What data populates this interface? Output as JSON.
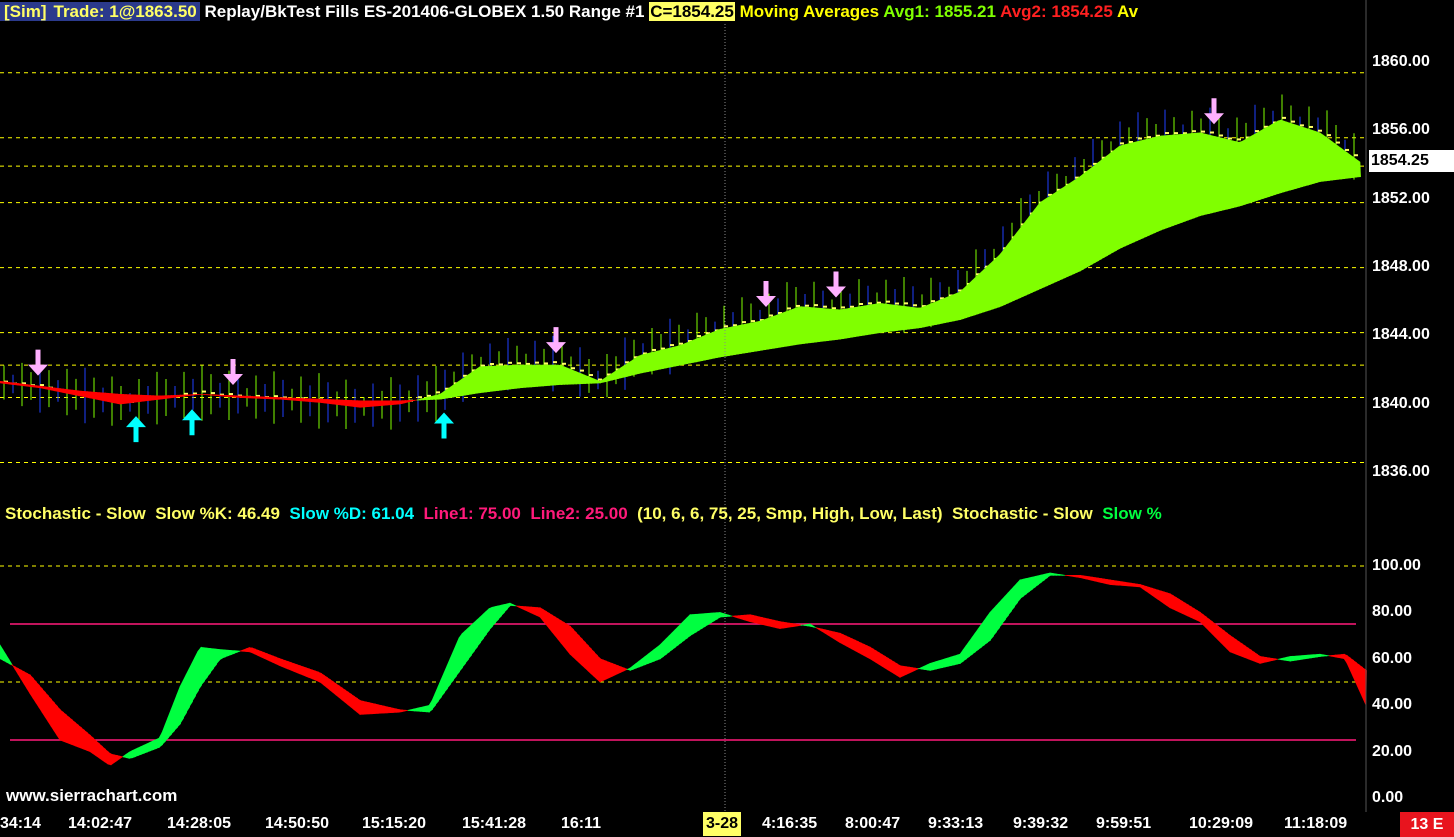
{
  "header": {
    "sim": "[Sim]",
    "trade": "Trade: 1@1863.50",
    "title": "Replay/BkTest Fills  ES-201406-GLOBEX  1.50 Range  #1",
    "close": "C=1854.25",
    "ma_label": "Moving Averages",
    "avg1": "Avg1: 1855.21",
    "avg2": "Avg2: 1854.25",
    "avg3": "Av"
  },
  "subgraph": {
    "name": "Stochastic - Slow",
    "k": "Slow %K: 46.49",
    "d": "Slow %D: 61.04",
    "line1": "Line1: 75.00",
    "line2": "Line2: 25.00",
    "params": "(10, 6, 6, 75, 25, Smp, High, Low, Last)",
    "name2": "Stochastic - Slow",
    "k2": "Slow %"
  },
  "price_axis": [
    "1860.00",
    "1856.00",
    "1852.00",
    "1848.00",
    "1844.00",
    "1840.00",
    "1836.00"
  ],
  "last_price": "1854.25",
  "stoch_axis": [
    "100.00",
    "80.00",
    "60.00",
    "40.00",
    "20.00",
    "0.00"
  ],
  "time_labels": [
    "34:14",
    "14:02:47",
    "14:28:05",
    "14:50:50",
    "15:15:20",
    "15:41:28",
    "16:11",
    "4:16:35",
    "8:00:47",
    "9:33:13",
    "9:39:32",
    "9:59:51",
    "10:29:09",
    "11:18:09"
  ],
  "date_label": "3-28",
  "corner_label": "13 E",
  "site": "www.sierrachart.com",
  "colors": {
    "up": "#80ff00",
    "down": "#ff0000",
    "stoch_up": "#00ff40",
    "buy_arrow": "#00ffff",
    "sell_arrow": "#ffb0ff",
    "grid": "#ffff00",
    "level": "#ff1a7a"
  },
  "chart_data": [
    {
      "type": "area",
      "title": "Moving Averages",
      "series": [
        {
          "name": "Avg1",
          "x": [
            0,
            40,
            80,
            120,
            160,
            200,
            240,
            280,
            320,
            360,
            400,
            440,
            480,
            520,
            560,
            600,
            640,
            680,
            720,
            760,
            800,
            840,
            880,
            920,
            960,
            1000,
            1040,
            1080,
            1120,
            1160,
            1200,
            1240,
            1280,
            1320,
            1360
          ],
          "values": [
            1840.9,
            1840.6,
            1840.1,
            1839.6,
            1839.9,
            1840.2,
            1840.0,
            1839.9,
            1839.7,
            1839.4,
            1839.6,
            1840.2,
            1841.9,
            1842.0,
            1842.0,
            1841.0,
            1842.6,
            1843.2,
            1844.2,
            1844.7,
            1845.6,
            1845.4,
            1845.8,
            1845.5,
            1846.5,
            1848.8,
            1852.0,
            1853.6,
            1855.5,
            1856.1,
            1856.3,
            1855.7,
            1857.1,
            1856.3,
            1854.5
          ]
        },
        {
          "name": "Avg2",
          "x": [
            0,
            40,
            80,
            120,
            160,
            200,
            240,
            280,
            320,
            360,
            400,
            440,
            480,
            520,
            560,
            600,
            640,
            680,
            720,
            760,
            800,
            840,
            880,
            920,
            960,
            1000,
            1040,
            1080,
            1120,
            1160,
            1200,
            1240,
            1280,
            1320,
            1360
          ],
          "values": [
            1841.0,
            1840.7,
            1840.4,
            1840.2,
            1840.1,
            1840.2,
            1840.1,
            1840.0,
            1839.9,
            1839.8,
            1839.8,
            1839.9,
            1840.3,
            1840.6,
            1840.8,
            1840.9,
            1841.5,
            1842.0,
            1842.5,
            1842.9,
            1843.3,
            1843.6,
            1844.0,
            1844.3,
            1844.8,
            1845.6,
            1846.7,
            1847.8,
            1849.2,
            1850.3,
            1851.2,
            1851.8,
            1852.6,
            1853.3,
            1853.6
          ]
        }
      ],
      "ylim": [
        1834,
        1863
      ],
      "sell_arrows_x": [
        38,
        233,
        556,
        766,
        836,
        1214
      ],
      "buy_arrows_x": [
        136,
        192,
        444
      ]
    },
    {
      "type": "area",
      "title": "Stochastic - Slow",
      "series": [
        {
          "name": "Slow %K",
          "x": [
            0,
            30,
            60,
            90,
            110,
            130,
            160,
            180,
            200,
            220,
            250,
            280,
            320,
            360,
            400,
            430,
            460,
            490,
            510,
            540,
            570,
            600,
            630,
            660,
            690,
            720,
            750,
            780,
            810,
            840,
            870,
            900,
            930,
            960,
            990,
            1020,
            1050,
            1080,
            1110,
            1140,
            1170,
            1200,
            1230,
            1260,
            1290,
            1320,
            1345,
            1366
          ],
          "values": [
            66,
            45,
            25,
            20,
            14,
            20,
            26,
            48,
            65,
            64,
            63,
            57,
            50,
            36,
            37,
            40,
            70,
            82,
            84,
            78,
            62,
            50,
            56,
            66,
            79,
            80,
            76,
            73,
            75,
            67,
            60,
            52,
            58,
            62,
            80,
            94,
            97,
            95,
            92,
            91,
            82,
            76,
            63,
            58,
            61,
            62,
            60,
            40
          ]
        },
        {
          "name": "Slow %D",
          "x": [
            0,
            30,
            60,
            90,
            110,
            130,
            160,
            180,
            200,
            220,
            250,
            280,
            320,
            360,
            400,
            430,
            460,
            490,
            510,
            540,
            570,
            600,
            630,
            660,
            690,
            720,
            750,
            780,
            810,
            840,
            870,
            900,
            930,
            960,
            990,
            1020,
            1050,
            1080,
            1110,
            1140,
            1170,
            1200,
            1230,
            1260,
            1290,
            1320,
            1345,
            1366
          ],
          "values": [
            60,
            53,
            38,
            27,
            19,
            17,
            22,
            32,
            48,
            60,
            65,
            60,
            54,
            42,
            38,
            37,
            55,
            73,
            83,
            82,
            74,
            60,
            55,
            60,
            70,
            78,
            79,
            76,
            74,
            71,
            65,
            57,
            55,
            58,
            68,
            86,
            96,
            96,
            94,
            92,
            88,
            80,
            70,
            61,
            59,
            61,
            62,
            55
          ]
        }
      ],
      "lines": [
        {
          "name": "Line1",
          "value": 75
        },
        {
          "name": "Line2",
          "value": 25
        }
      ],
      "ylim": [
        0,
        100
      ]
    }
  ]
}
